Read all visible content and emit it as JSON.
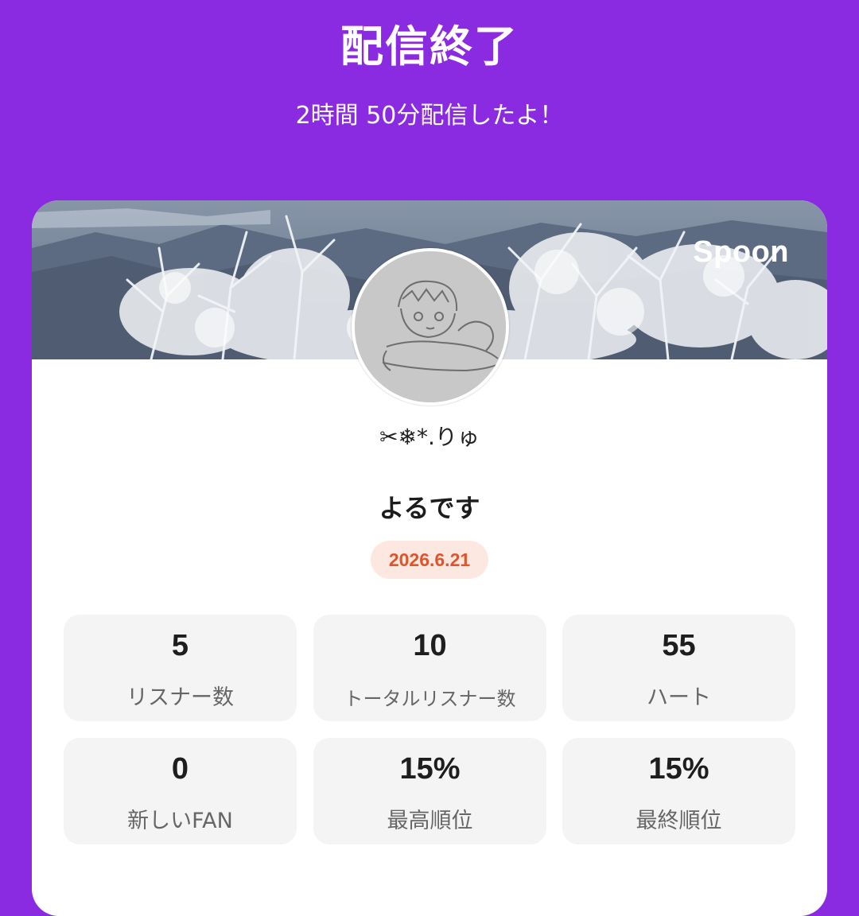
{
  "header": {
    "title": "配信終了",
    "duration_text": "2時間 50分配信したよ！"
  },
  "card": {
    "brand": "Spoon",
    "username": "✂︎❄︎*.りゅ",
    "stream_title": "よるです",
    "date": "2026.6.21",
    "stats": [
      {
        "value": "5",
        "label": "リスナー数"
      },
      {
        "value": "10",
        "label": "トータルリスナー数"
      },
      {
        "value": "55",
        "label": "ハート"
      },
      {
        "value": "0",
        "label": "新しいFAN"
      },
      {
        "value": "15%",
        "label": "最高順位"
      },
      {
        "value": "15%",
        "label": "最終順位"
      }
    ]
  },
  "colors": {
    "background": "#8a2be2",
    "date_badge_bg": "#fde8e1",
    "date_badge_text": "#e0542a",
    "stat_tile_bg": "#f4f4f4"
  }
}
